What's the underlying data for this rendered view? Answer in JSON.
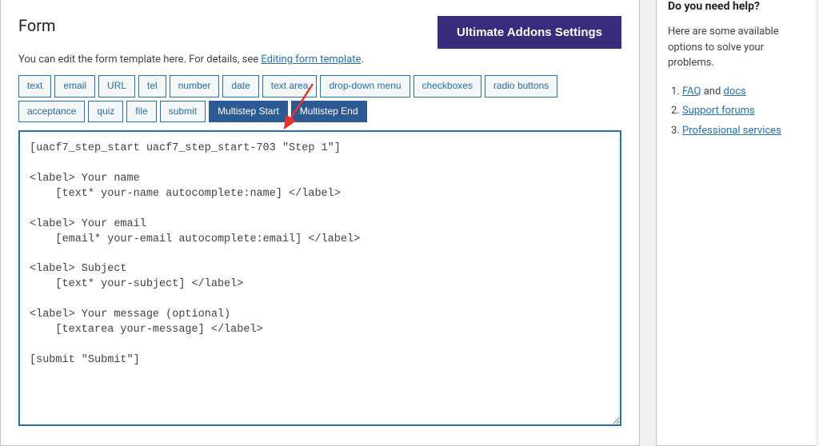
{
  "main": {
    "title": "Form",
    "ultimate_btn": "Ultimate Addons Settings",
    "subtitle_prefix": "You can edit the form template here. For details, see ",
    "subtitle_link": "Editing form template",
    "subtitle_suffix": ".",
    "tag_buttons": [
      "text",
      "email",
      "URL",
      "tel",
      "number",
      "date",
      "text area",
      "drop-down menu",
      "checkboxes",
      "radio buttons",
      "acceptance",
      "quiz",
      "file",
      "submit",
      "Multistep Start",
      "Multistep End"
    ],
    "active_tags": [
      "Multistep Start",
      "Multistep End"
    ],
    "textarea_value": "[uacf7_step_start uacf7_step_start-703 \"Step 1\"]\n\n<label> Your name\n    [text* your-name autocomplete:name] </label>\n\n<label> Your email\n    [email* your-email autocomplete:email] </label>\n\n<label> Subject\n    [text* your-subject] </label>\n\n<label> Your message (optional)\n    [textarea your-message] </label>\n\n[submit \"Submit\"]"
  },
  "help": {
    "title": "Do you need help?",
    "desc": "Here are some available options to solve your problems.",
    "items": [
      {
        "prefix": "",
        "link1": "FAQ",
        "mid": " and ",
        "link2": "docs",
        "suffix": ""
      },
      {
        "prefix": "",
        "link1": "Support forums",
        "mid": "",
        "link2": "",
        "suffix": ""
      },
      {
        "prefix": "",
        "link1": "Professional services",
        "mid": "",
        "link2": "",
        "suffix": ""
      }
    ]
  }
}
